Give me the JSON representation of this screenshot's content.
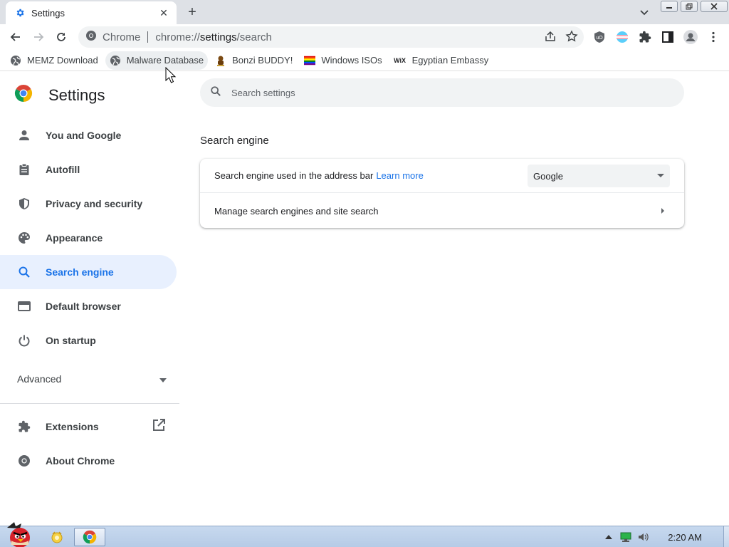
{
  "browser": {
    "tab": {
      "title": "Settings",
      "icon": "gear-icon"
    },
    "omnibox": {
      "chip": "Chrome",
      "url_prefix": "chrome://",
      "url_path": "settings",
      "url_suffix": "/search"
    }
  },
  "bookmarks": [
    {
      "label": "MEMZ Download",
      "icon": "globe-icon"
    },
    {
      "label": "Malware Database",
      "icon": "globe-icon"
    },
    {
      "label": "Bonzi BUDDY!",
      "icon": "bonzi-icon"
    },
    {
      "label": "Windows ISOs",
      "icon": "pride-flag-icon"
    },
    {
      "label": "Egyptian Embassy",
      "icon": "wix-icon",
      "icon_text": "WiX"
    }
  ],
  "sidebar": {
    "title": "Settings",
    "items": [
      {
        "label": "You and Google",
        "icon": "person-icon"
      },
      {
        "label": "Autofill",
        "icon": "clipboard-icon"
      },
      {
        "label": "Privacy and security",
        "icon": "shield-icon"
      },
      {
        "label": "Appearance",
        "icon": "palette-icon"
      },
      {
        "label": "Search engine",
        "icon": "search-icon",
        "active": true
      },
      {
        "label": "Default browser",
        "icon": "browser-icon"
      },
      {
        "label": "On startup",
        "icon": "power-icon"
      }
    ],
    "advanced": "Advanced",
    "extensions": "Extensions",
    "about": "About Chrome"
  },
  "main": {
    "search_placeholder": "Search settings",
    "section_title": "Search engine",
    "row1_label": "Search engine used in the address bar",
    "row1_link": "Learn more",
    "row1_value": "Google",
    "row2_label": "Manage search engines and site search"
  },
  "taskbar": {
    "clock": "2:20 AM"
  },
  "colors": {
    "accent": "#1a73e8",
    "active_nav_bg": "#e8f0fe"
  }
}
